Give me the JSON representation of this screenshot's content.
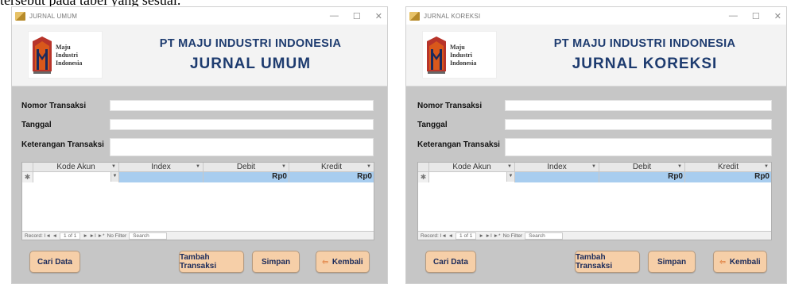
{
  "top_caption": "tersebut pada tabel yang sesuai.",
  "colors": {
    "form_bg": "#c6c6c6",
    "header_bg": "#f3f3f3",
    "title_blue": "#1d3b6f",
    "button_bg": "#f6cfa8",
    "row_selected": "#a8cdef",
    "logo_orange": "#d9581b"
  },
  "logo": {
    "line1": "Maju",
    "line2": "Industri",
    "line3": "Indonesia"
  },
  "windows": [
    {
      "title": "JURNAL UMUM",
      "company": "PT MAJU INDUSTRI INDONESIA",
      "heading": "JURNAL UMUM",
      "labels": {
        "nomor": "Nomor Transaksi",
        "tanggal": "Tanggal",
        "keterangan": "Keterangan Transaksi"
      },
      "columns": [
        "Kode Akun",
        "Index",
        "Debit",
        "Kredit"
      ],
      "row": {
        "debit": "Rp0",
        "kredit": "Rp0"
      },
      "record_nav": {
        "label": "Record: I◄ ◄",
        "count": "1 of 1",
        "next": "► ►I ►*",
        "filter": "No Filter",
        "search": "Search"
      },
      "buttons": {
        "cari": "Cari Data",
        "tambah": "Tambah Transaksi",
        "simpan": "Simpan",
        "kembali": "Kembali"
      }
    },
    {
      "title": "JURNAL KOREKSI",
      "company": "PT MAJU INDUSTRI INDONESIA",
      "heading": "JURNAL KOREKSI",
      "labels": {
        "nomor": "Nomor Transaksi",
        "tanggal": "Tanggal",
        "keterangan": "Keterangan Transaksi"
      },
      "columns": [
        "Kode Akun",
        "Index",
        "Debit",
        "Kredit"
      ],
      "row": {
        "debit": "Rp0",
        "kredit": "Rp0"
      },
      "record_nav": {
        "label": "Record: I◄ ◄",
        "count": "1 of 1",
        "next": "► ►I ►*",
        "filter": "No Filter",
        "search": "Search"
      },
      "buttons": {
        "cari": "Cari Data",
        "tambah": "Tambah Transaksi",
        "simpan": "Simpan",
        "kembali": "Kembali"
      }
    }
  ],
  "window_controls": {
    "minimize": "—",
    "maximize": "☐",
    "close": "✕"
  }
}
